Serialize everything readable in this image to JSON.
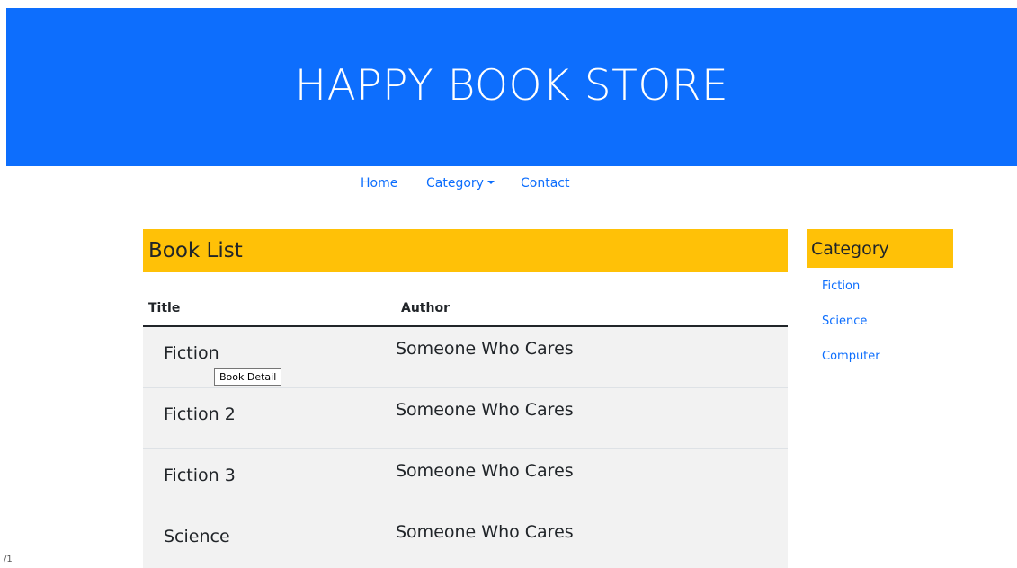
{
  "store_title": "HAPPY BOOK STORE",
  "nav": {
    "home": "Home",
    "category": "Category",
    "contact": "Contact"
  },
  "book_list": {
    "heading": "Book List",
    "columns": [
      "Title",
      "Author"
    ],
    "rows": [
      {
        "title": "Fiction",
        "author": "Someone Who Cares"
      },
      {
        "title": "Fiction 2",
        "author": "Someone Who Cares"
      },
      {
        "title": "Fiction 3",
        "author": "Someone Who Cares"
      },
      {
        "title": "Science",
        "author": "Someone Who Cares"
      }
    ],
    "tooltip": "Book Detail"
  },
  "sidebar": {
    "heading": "Category",
    "items": [
      "Fiction",
      "Science",
      "Computer"
    ]
  },
  "page_indicator": "/1",
  "colors": {
    "banner": "#0d6efd",
    "section_header": "#ffc107",
    "link": "#0d6efd",
    "row_bg": "#f2f2f2"
  }
}
